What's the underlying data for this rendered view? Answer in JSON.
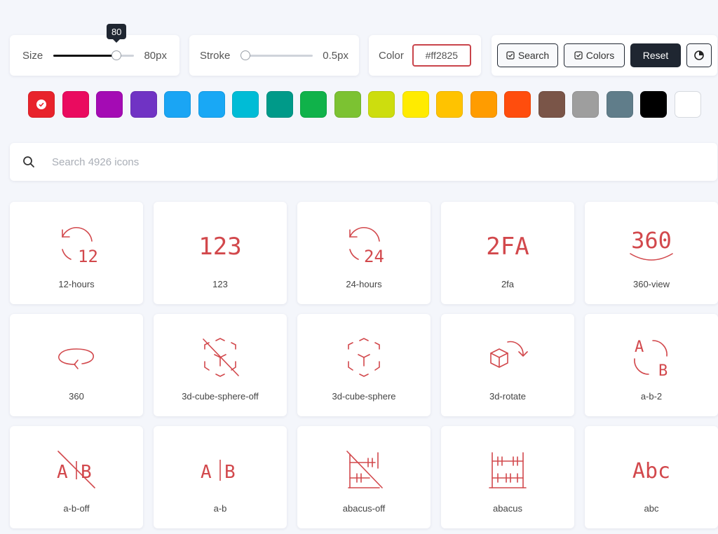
{
  "controls": {
    "size": {
      "label": "Size",
      "value": 80,
      "value_text": "80px",
      "tooltip": "80",
      "fraction": 0.78
    },
    "stroke": {
      "label": "Stroke",
      "value_text": "0.5px",
      "fraction": 0.0
    },
    "color": {
      "label": "Color",
      "value": "#ff2825"
    },
    "buttons": {
      "search": "Search",
      "colors": "Colors",
      "reset": "Reset"
    }
  },
  "swatches": [
    "#e8232b",
    "#ea0b5f",
    "#a40bb4",
    "#7033c4",
    "#1aa5f4",
    "#19a8f5",
    "#00bcd6",
    "#009a89",
    "#10b24a",
    "#7cc232",
    "#cddd0e",
    "#ffeb00",
    "#ffc300",
    "#ff9c00",
    "#ff4d0d",
    "#7a5548",
    "#9e9e9e",
    "#607d8a",
    "#000000",
    "#ffffff"
  ],
  "selected_swatch": 0,
  "search": {
    "placeholder": "Search 4926 icons"
  },
  "icon_color": "#d2484c",
  "icons": [
    {
      "name": "12-hours"
    },
    {
      "name": "123"
    },
    {
      "name": "24-hours"
    },
    {
      "name": "2fa"
    },
    {
      "name": "360-view"
    },
    {
      "name": "360"
    },
    {
      "name": "3d-cube-sphere-off"
    },
    {
      "name": "3d-cube-sphere"
    },
    {
      "name": "3d-rotate"
    },
    {
      "name": "a-b-2"
    },
    {
      "name": "a-b-off"
    },
    {
      "name": "a-b"
    },
    {
      "name": "abacus-off"
    },
    {
      "name": "abacus"
    },
    {
      "name": "abc"
    }
  ],
  "glyph_text": {
    "g12": "12",
    "g123": "123",
    "g24": "24",
    "g2fa": "2FA",
    "g360": "360",
    "gA": "A",
    "gB": "B",
    "gAB_A": "A",
    "gAB_B": "B",
    "gAbc": "Abc"
  }
}
